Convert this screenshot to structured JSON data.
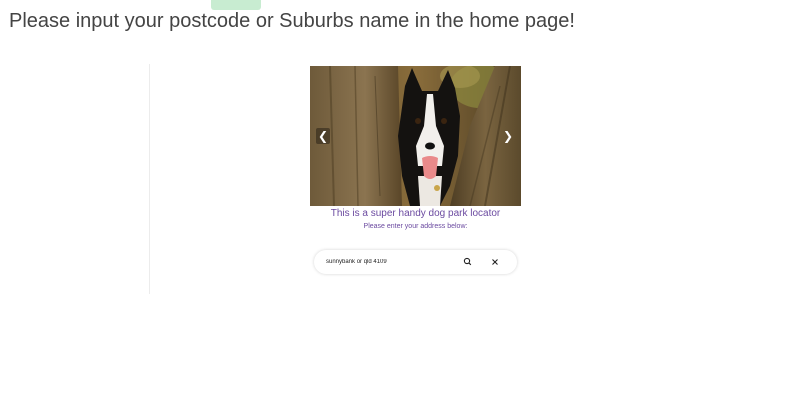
{
  "headline": "Please input your postcode or Suburbs name in the home page!",
  "carousel": {
    "prev_label": "❮",
    "next_label": "❯"
  },
  "tagline": "This is a super handy dog park locator",
  "subline": "Please enter your address below:",
  "search": {
    "placeholder": "sunnybank or qld 4109",
    "search_icon": "search-icon",
    "clear_icon": "close-icon"
  },
  "colors": {
    "accent_purple": "#6b4aa0",
    "tab_green": "#c8ecd1"
  }
}
